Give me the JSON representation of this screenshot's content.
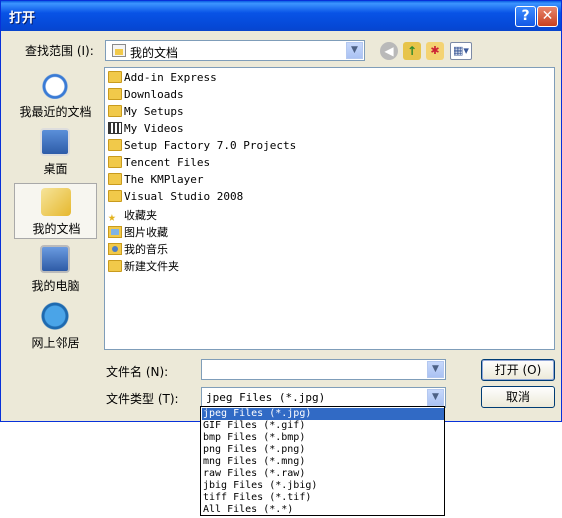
{
  "window": {
    "title": "打开",
    "help_glyph": "?",
    "close_glyph": "✕"
  },
  "lookin": {
    "label": "查找范围 (I):",
    "value": "我的文档"
  },
  "places": [
    {
      "label": "我最近的文档",
      "icon": "recent-documents-icon",
      "selected": false
    },
    {
      "label": "桌面",
      "icon": "desktop-icon",
      "selected": false
    },
    {
      "label": "我的文档",
      "icon": "my-documents-icon",
      "selected": true
    },
    {
      "label": "我的电脑",
      "icon": "my-computer-icon",
      "selected": false
    },
    {
      "label": "网上邻居",
      "icon": "network-places-icon",
      "selected": false
    }
  ],
  "files": [
    {
      "name": "Add-in Express",
      "icon": "folder-icon"
    },
    {
      "name": "Downloads",
      "icon": "folder-icon"
    },
    {
      "name": "My Setups",
      "icon": "folder-icon"
    },
    {
      "name": "My Videos",
      "icon": "videos-folder-icon"
    },
    {
      "name": "Setup Factory 7.0 Projects",
      "icon": "folder-icon"
    },
    {
      "name": "Tencent Files",
      "icon": "folder-icon"
    },
    {
      "name": "The KMPlayer",
      "icon": "folder-icon"
    },
    {
      "name": "Visual Studio 2008",
      "icon": "folder-icon"
    },
    {
      "name": "收藏夹",
      "icon": "favorites-icon"
    },
    {
      "name": "图片收藏",
      "icon": "pictures-folder-icon"
    },
    {
      "name": "我的音乐",
      "icon": "music-folder-icon"
    },
    {
      "name": "新建文件夹",
      "icon": "folder-icon"
    }
  ],
  "filename": {
    "label": "文件名 (N):",
    "value": ""
  },
  "filetype": {
    "label": "文件类型 (T):",
    "value": "jpeg Files (*.jpg)",
    "options": [
      "jpeg Files (*.jpg)",
      "GIF Files (*.gif)",
      "bmp Files (*.bmp)",
      "png Files (*.png)",
      "mng Files (*.mng)",
      "raw Files (*.raw)",
      "jbig Files (*.jbig)",
      "tiff Files (*.tif)",
      "All Files (*.*)"
    ],
    "selected_index": 0
  },
  "buttons": {
    "open": "打开 (O)",
    "cancel": "取消"
  },
  "colors": {
    "title_bar": "#0853e6",
    "selection": "#316ac5",
    "dialog_bg": "#ece9d8"
  }
}
